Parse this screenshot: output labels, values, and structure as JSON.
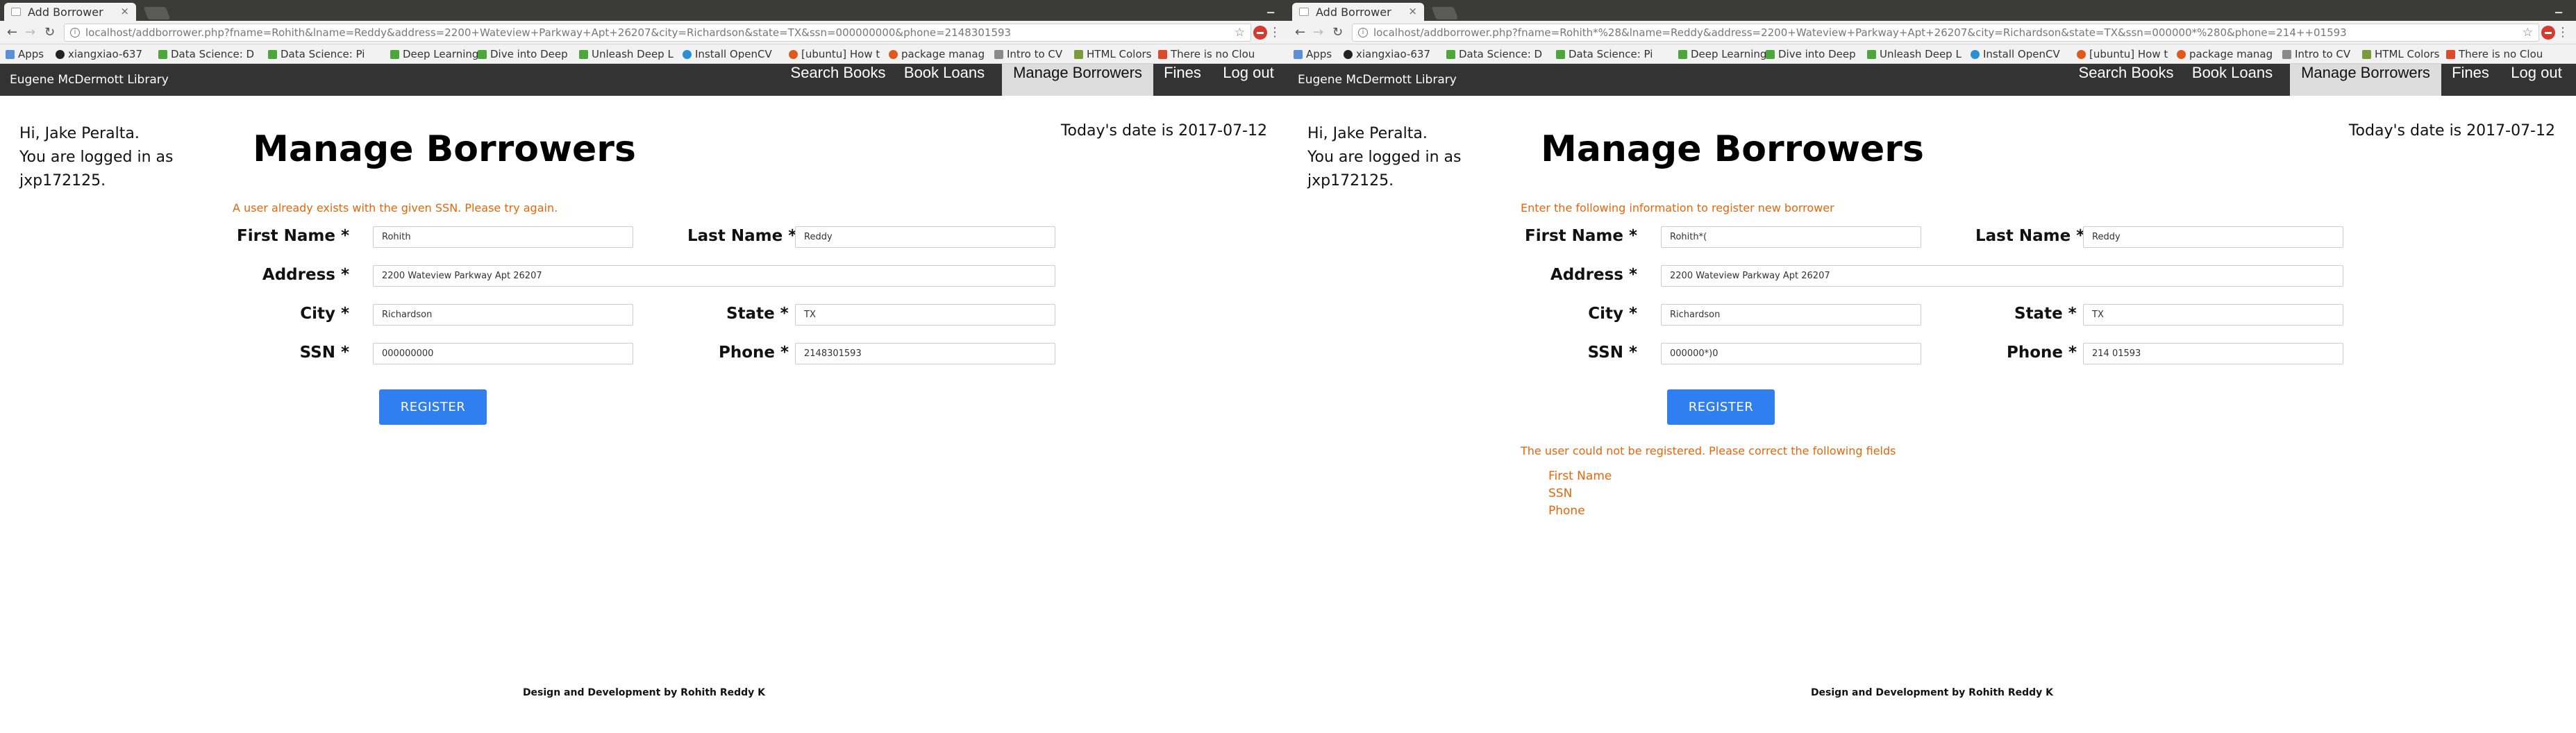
{
  "windows": [
    {
      "tab": {
        "title": "Add Borrower",
        "close": "×"
      },
      "url": "localhost/addborrower.php?fname=Rohith&lname=Reddy&address=2200+Wateview+Parkway+Apt+26207&city=Richardson&state=TX&ssn=000000000&phone=2148301593",
      "bookmarks": [
        "Apps",
        "xiangxiao-637",
        "Data Science: D",
        "Data Science: Pi",
        "Deep Learning",
        "Dive into Deep",
        "Unleash Deep L",
        "Install OpenCV",
        "[ubuntu] How t",
        "package manag",
        "Intro to CV",
        "HTML Colors",
        "There is no Clou"
      ],
      "brand": "Eugene McDermott Library",
      "nav": [
        "Search Books",
        "Book Loans",
        "Manage Borrowers",
        "Fines",
        "Log out"
      ],
      "greeting": [
        "Hi, Jake Peralta.",
        "You are logged in as",
        "jxp172125."
      ],
      "date": "Today's date is 2017-07-12",
      "heading": "Manage Borrowers",
      "message": "A user already exists with the given SSN. Please try again.",
      "labels": {
        "first_name": "First Name *",
        "last_name": "Last Name *",
        "address": "Address *",
        "city": "City *",
        "state": "State *",
        "ssn": "SSN *",
        "phone": "Phone *"
      },
      "values": {
        "first_name": "Rohith",
        "last_name": "Reddy",
        "address": "2200 Wateview Parkway Apt 26207",
        "city": "Richardson",
        "state": "TX",
        "ssn": "000000000",
        "phone": "2148301593"
      },
      "register": "REGISTER",
      "error_title": "",
      "error_fields": [],
      "footer": "Design and Development by Rohith Reddy K"
    },
    {
      "tab": {
        "title": "Add Borrower",
        "close": "×"
      },
      "url": "localhost/addborrower.php?fname=Rohith*%28&lname=Reddy&address=2200+Wateview+Parkway+Apt+26207&city=Richardson&state=TX&ssn=000000*%280&phone=214++01593",
      "bookmarks": [
        "Apps",
        "xiangxiao-637",
        "Data Science: D",
        "Data Science: Pi",
        "Deep Learning",
        "Dive into Deep",
        "Unleash Deep L",
        "Install OpenCV",
        "[ubuntu] How t",
        "package manag",
        "Intro to CV",
        "HTML Colors",
        "There is no Clou"
      ],
      "brand": "Eugene McDermott Library",
      "nav": [
        "Search Books",
        "Book Loans",
        "Manage Borrowers",
        "Fines",
        "Log out"
      ],
      "greeting": [
        "Hi, Jake Peralta.",
        "You are logged in as",
        "jxp172125."
      ],
      "date": "Today's date is 2017-07-12",
      "heading": "Manage Borrowers",
      "message": "Enter the following information to register new borrower",
      "labels": {
        "first_name": "First Name *",
        "last_name": "Last Name *",
        "address": "Address *",
        "city": "City *",
        "state": "State *",
        "ssn": "SSN *",
        "phone": "Phone *"
      },
      "values": {
        "first_name": "Rohith*(",
        "last_name": "Reddy",
        "address": "2200 Wateview Parkway Apt 26207",
        "city": "Richardson",
        "state": "TX",
        "ssn": "000000*)0",
        "phone": "214  01593"
      },
      "register": "REGISTER",
      "error_title": "The user could not be registered. Please correct the following fields",
      "error_fields": [
        "First Name",
        "SSN",
        "Phone"
      ],
      "footer": "Design and Development by Rohith Reddy K"
    }
  ],
  "colors": {
    "navbar": "#333333",
    "active_nav": "#dddddd",
    "accent_button": "#2f7ff0",
    "message": "#e8650c"
  }
}
